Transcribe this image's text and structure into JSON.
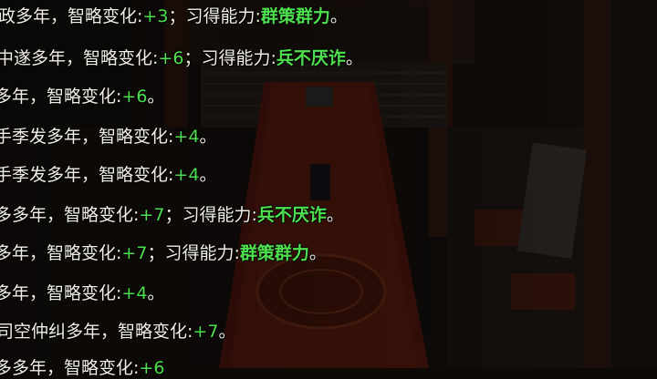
{
  "log": {
    "lines": [
      {
        "prefix": "政多年，",
        "stat": "智略变化:",
        "value": "+3",
        "sep": "；",
        "ability_label": "习得能力:",
        "ability": "群策群力",
        "end": "。"
      },
      {
        "prefix": "中遂多年，",
        "stat": "智略变化:",
        "value": "+6",
        "sep": "；",
        "ability_label": "习得能力:",
        "ability": "兵不厌诈",
        "end": "。"
      },
      {
        "prefix": "多年，",
        "stat": "智略变化:",
        "value": "+6",
        "sep": "",
        "ability_label": "",
        "ability": "",
        "end": "。"
      },
      {
        "prefix": "手季发多年，",
        "stat": "智略变化:",
        "value": "+4",
        "sep": "",
        "ability_label": "",
        "ability": "",
        "end": "。"
      },
      {
        "prefix": "手季发多年，",
        "stat": "智略变化:",
        "value": "+4",
        "sep": "",
        "ability_label": "",
        "ability": "",
        "end": "。"
      },
      {
        "prefix": "多多年，",
        "stat": "智略变化:",
        "value": "+7",
        "sep": "；",
        "ability_label": "习得能力:",
        "ability": "兵不厌诈",
        "end": "。"
      },
      {
        "prefix": "多年，",
        "stat": "智略变化:",
        "value": "+7",
        "sep": "；",
        "ability_label": "习得能力:",
        "ability": "群策群力",
        "end": "。"
      },
      {
        "prefix": "多年，",
        "stat": "智略变化:",
        "value": "+4",
        "sep": "",
        "ability_label": "",
        "ability": "",
        "end": "。"
      },
      {
        "prefix": "司空仲纠多年，",
        "stat": "智略变化:",
        "value": "+7",
        "sep": "",
        "ability_label": "",
        "ability": "",
        "end": "。"
      },
      {
        "prefix": "多多年，",
        "stat": "智略变化:",
        "value": "+6",
        "sep": "",
        "ability_label": "",
        "ability": "",
        "end": ""
      }
    ]
  }
}
